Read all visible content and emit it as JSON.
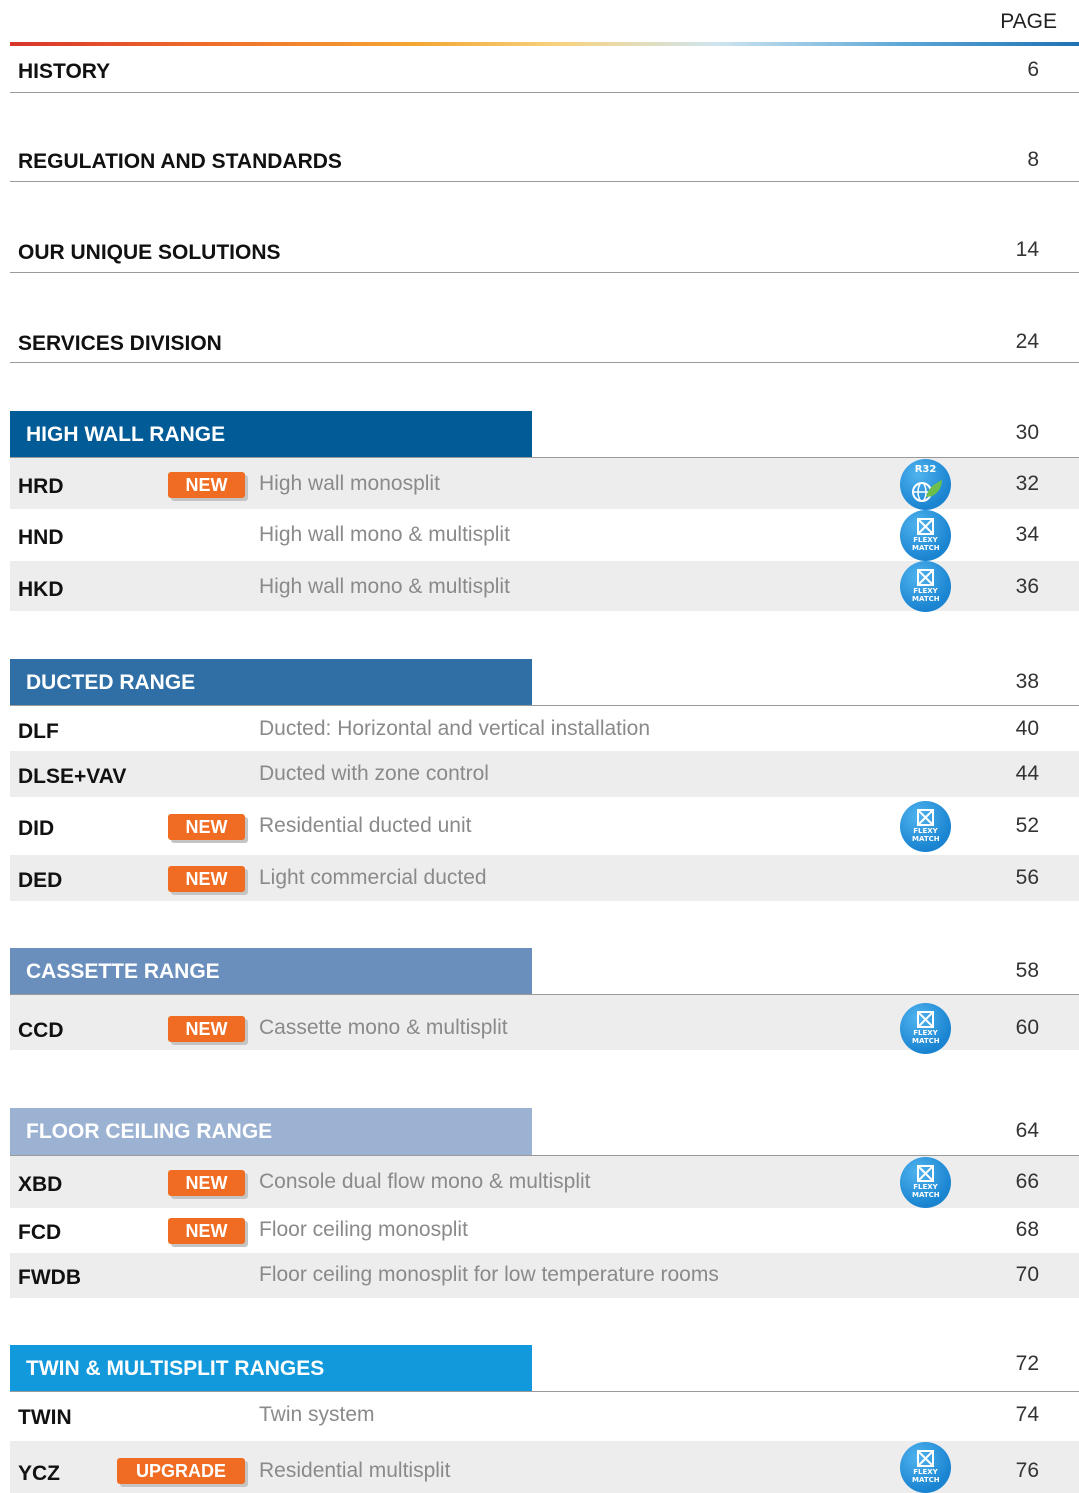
{
  "header": {
    "page_label": "PAGE"
  },
  "sections": [
    {
      "title": "HISTORY",
      "page": "6"
    },
    {
      "title": "REGULATION AND STANDARDS",
      "page": "8"
    },
    {
      "title": "OUR UNIQUE SOLUTIONS",
      "page": "14"
    },
    {
      "title": "SERVICES DIVISION",
      "page": "24"
    }
  ],
  "ranges": [
    {
      "title": "HIGH WALL RANGE",
      "page": "30",
      "color": "#005b97",
      "items": [
        {
          "code": "HRD",
          "badge": "NEW",
          "desc": "High wall monosplit",
          "icon": "r32-icon",
          "icon_text": "R32",
          "page": "32"
        },
        {
          "code": "HND",
          "badge": "",
          "desc": "High wall mono & multisplit",
          "icon": "flexy-match-icon",
          "icon_text": "FLEXY MATCH",
          "page": "34"
        },
        {
          "code": "HKD",
          "badge": "",
          "desc": "High wall mono & multisplit",
          "icon": "flexy-match-icon",
          "icon_text": "FLEXY MATCH",
          "page": "36"
        }
      ]
    },
    {
      "title": "DUCTED RANGE",
      "page": "38",
      "color": "#2f6fa6",
      "items": [
        {
          "code": "DLF",
          "badge": "",
          "desc": "Ducted:  Horizontal and vertical installation",
          "page": "40"
        },
        {
          "code": "DLSE+VAV",
          "badge": "",
          "desc": "Ducted with zone control",
          "page": "44"
        },
        {
          "code": "DID",
          "badge": "NEW",
          "desc": "Residential ducted unit",
          "icon": "flexy-match-icon",
          "icon_text": "FLEXY MATCH",
          "page": "52"
        },
        {
          "code": "DED",
          "badge": "NEW",
          "desc": "Light commercial ducted",
          "page": "56"
        }
      ]
    },
    {
      "title": "CASSETTE RANGE",
      "page": "58",
      "color": "#6a8fbd",
      "items": [
        {
          "code": "CCD",
          "badge": "NEW",
          "desc": "Cassette mono & multisplit",
          "icon": "flexy-match-icon",
          "icon_text": "FLEXY MATCH",
          "page": "60"
        }
      ]
    },
    {
      "title": "FLOOR CEILING RANGE",
      "page": "64",
      "color": "#9cb2d3",
      "items": [
        {
          "code": "XBD",
          "badge": "NEW",
          "desc": "Console dual flow mono & multisplit",
          "icon": "flexy-match-icon",
          "icon_text": "FLEXY MATCH",
          "page": "66"
        },
        {
          "code": "FCD",
          "badge": "NEW",
          "desc": "Floor ceiling monosplit",
          "page": "68"
        },
        {
          "code": "FWDB",
          "badge": "",
          "desc": "Floor ceiling monosplit for low temperature rooms",
          "page": "70"
        }
      ]
    },
    {
      "title": "TWIN & MULTISPLIT RANGES",
      "page": "72",
      "color": "#1199dc",
      "items": [
        {
          "code": "TWIN",
          "badge": "",
          "desc": "Twin system",
          "page": "74"
        },
        {
          "code": "YCZ",
          "badge": "UPGRADE",
          "desc": "Residential multisplit",
          "icon": "flexy-match-icon",
          "icon_text": "FLEXY MATCH",
          "page": "76"
        }
      ]
    }
  ]
}
